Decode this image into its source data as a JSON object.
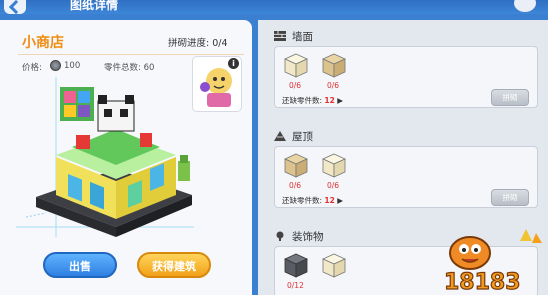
{
  "header": {
    "title": "图纸详情"
  },
  "left": {
    "shop_name": "小商店",
    "progress": "拼砌进度: 0/4",
    "price_label": "价格:",
    "price_value": "100",
    "parts_total": "零件总数: 60",
    "sell_button": "出售",
    "obtain_button": "获得建筑"
  },
  "sections": [
    {
      "title": "墙面",
      "icon": "wall-icon",
      "parts": [
        {
          "count": "0/6",
          "color": "#f3ecd2"
        },
        {
          "count": "0/6",
          "color": "#dcc28d"
        }
      ],
      "missing_label": "还缺零件数:",
      "missing_value": "12",
      "assemble_label": "拼砌"
    },
    {
      "title": "屋顶",
      "icon": "roof-icon",
      "parts": [
        {
          "count": "0/6",
          "color": "#dcc28d"
        },
        {
          "count": "0/6",
          "color": "#f3ecd2"
        }
      ],
      "missing_label": "还缺零件数:",
      "missing_value": "12",
      "assemble_label": "拼砌"
    },
    {
      "title": "装饰物",
      "icon": "decoration-icon",
      "parts": [
        {
          "count": "0/12",
          "color": "#595c62"
        },
        {
          "count": "",
          "color": "#f3ecd2"
        }
      ]
    }
  ],
  "watermark": {
    "text": "18183"
  },
  "colors": {
    "accent_orange": "#ef8d14",
    "missing_red": "#e03030",
    "sell_blue": "#2f80e2",
    "obtain_yellow": "#f2a11a"
  }
}
